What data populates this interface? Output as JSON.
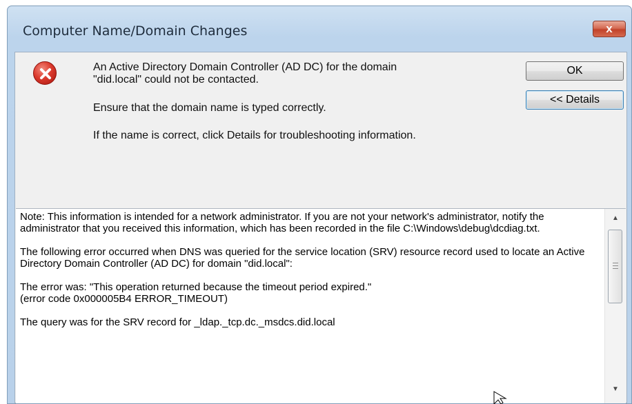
{
  "dialog": {
    "title": "Computer Name/Domain Changes",
    "close_glyph": "x",
    "icon": "error-icon",
    "message_line1": "An Active Directory Domain Controller (AD DC) for the domain",
    "message_line2": "\"did.local\" could not be contacted.",
    "message_ensure": "Ensure that the domain name is typed correctly.",
    "message_details_hint": "If the name is correct, click Details for troubleshooting information.",
    "ok_label": "OK",
    "details_label": "<< Details"
  },
  "details": {
    "paragraph1": "Note: This information is intended for a network administrator.  If you are not your network's administrator, notify the administrator that you received this information, which has been recorded in the file C:\\Windows\\debug\\dcdiag.txt.",
    "paragraph2": "The following error occurred when DNS was queried for the service location (SRV) resource record used to locate an Active Directory Domain Controller (AD DC) for domain \"did.local\":",
    "paragraph3_line1": "The error was: \"This operation returned because the timeout period expired.\"",
    "paragraph3_line2": "(error code 0x000005B4 ERROR_TIMEOUT)",
    "paragraph4": "The query was for the SRV record for _ldap._tcp.dc._msdcs.did.local",
    "scroll_position": 0.0
  },
  "colors": {
    "frame": "#b9d1ea",
    "close_button": "#c2432a",
    "error_icon": "#dc3b2e",
    "dialog_bg": "#f0f0f0"
  }
}
